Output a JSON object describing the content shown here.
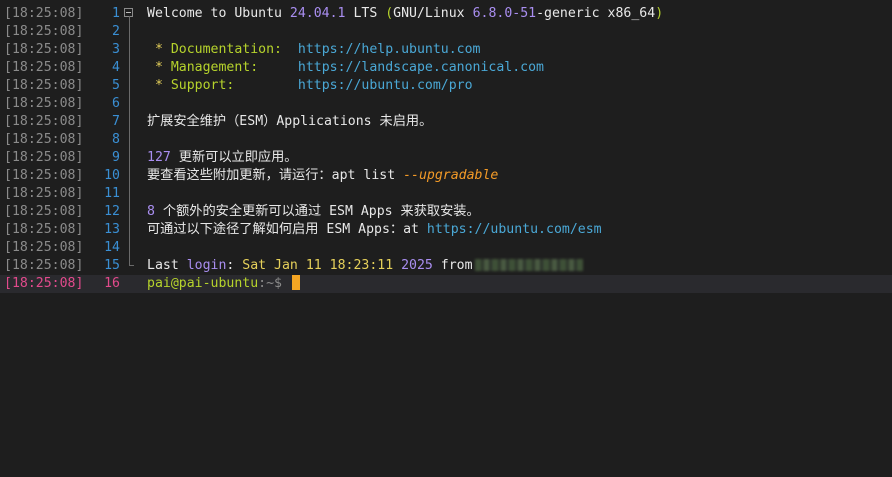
{
  "terminal": {
    "timestamp": "[18:25:08]",
    "lines": [
      {
        "n": "1",
        "segs": [
          {
            "t": "Welcome to Ubuntu ",
            "c": "white"
          },
          {
            "t": "24.04.1",
            "c": "purple"
          },
          {
            "t": " LTS ",
            "c": "white"
          },
          {
            "t": "(",
            "c": "green"
          },
          {
            "t": "GNU/Linux ",
            "c": "white"
          },
          {
            "t": "6.8.0-51",
            "c": "purple"
          },
          {
            "t": "-generic x86_64",
            "c": "white"
          },
          {
            "t": ")",
            "c": "green"
          }
        ]
      },
      {
        "n": "2",
        "segs": []
      },
      {
        "n": "3",
        "segs": [
          {
            "t": " * ",
            "c": "yellow"
          },
          {
            "t": "Documentation:  ",
            "c": "green"
          },
          {
            "t": "https://help.ubuntu.com",
            "c": "blue"
          }
        ]
      },
      {
        "n": "4",
        "segs": [
          {
            "t": " * ",
            "c": "yellow"
          },
          {
            "t": "Management:     ",
            "c": "green"
          },
          {
            "t": "https://landscape.canonical.com",
            "c": "blue"
          }
        ]
      },
      {
        "n": "5",
        "segs": [
          {
            "t": " * ",
            "c": "yellow"
          },
          {
            "t": "Support:        ",
            "c": "green"
          },
          {
            "t": "https://ubuntu.com/pro",
            "c": "blue"
          }
        ]
      },
      {
        "n": "6",
        "segs": []
      },
      {
        "n": "7",
        "segs": [
          {
            "t": "扩展安全维护（ESM）Applications 未启用。",
            "c": "white"
          }
        ]
      },
      {
        "n": "8",
        "segs": []
      },
      {
        "n": "9",
        "segs": [
          {
            "t": "127",
            "c": "purple"
          },
          {
            "t": " 更新可以立即应用。",
            "c": "white"
          }
        ]
      },
      {
        "n": "10",
        "segs": [
          {
            "t": "要查看这些附加更新，请运行：apt list ",
            "c": "white"
          },
          {
            "t": "--upgradable",
            "c": "orange"
          }
        ]
      },
      {
        "n": "11",
        "segs": []
      },
      {
        "n": "12",
        "segs": [
          {
            "t": "8",
            "c": "purple"
          },
          {
            "t": " 个额外的安全更新可以通过 ESM Apps 来获取安装。",
            "c": "white"
          }
        ]
      },
      {
        "n": "13",
        "segs": [
          {
            "t": "可通过以下途径了解如何启用 ESM Apps：at ",
            "c": "white"
          },
          {
            "t": "https://ubuntu.com/esm",
            "c": "blue"
          }
        ]
      },
      {
        "n": "14",
        "segs": []
      },
      {
        "n": "15",
        "segs": [
          {
            "t": "Last ",
            "c": "white"
          },
          {
            "t": "login",
            "c": "purple"
          },
          {
            "t": ": ",
            "c": "white"
          },
          {
            "t": "Sat Jan 11 18:23:11 ",
            "c": "yellow"
          },
          {
            "t": "2025",
            "c": "purple"
          },
          {
            "t": " from",
            "c": "white"
          }
        ],
        "redacted": true
      },
      {
        "n": "16",
        "segs": [
          {
            "t": "pai@pai-ubuntu",
            "c": "green"
          },
          {
            "t": ":~$ ",
            "c": "gray"
          }
        ],
        "current": true,
        "cursor": true
      }
    ]
  },
  "colors": {
    "background": "#1e1e1e",
    "current_line_bg": "#2a2a2e",
    "cursor": "#f5a623",
    "timestamp_active": "#e24a8c",
    "line_number": "#3a8fd4"
  }
}
